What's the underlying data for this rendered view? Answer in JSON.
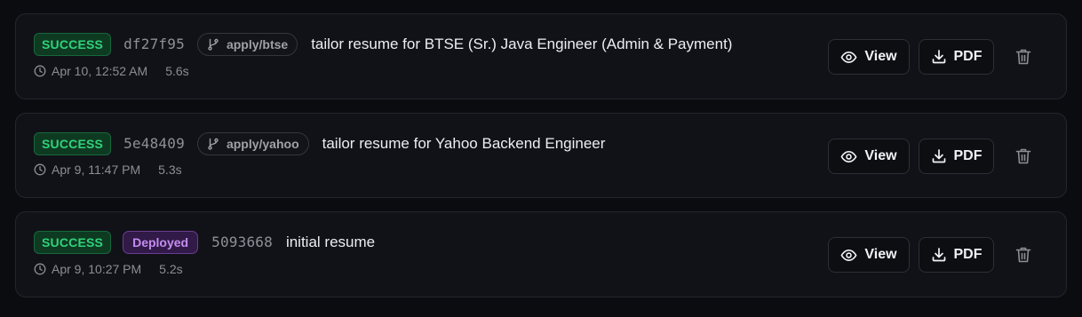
{
  "deployments": [
    {
      "status": "SUCCESS",
      "sha": "df27f95",
      "branch": "apply/btse",
      "deployed_label": "",
      "message": "tailor resume for BTSE (Sr.) Java Engineer (Admin & Payment)",
      "time": "Apr 10, 12:52 AM",
      "duration": "5.6s",
      "view_label": "View",
      "pdf_label": "PDF"
    },
    {
      "status": "SUCCESS",
      "sha": "5e48409",
      "branch": "apply/yahoo",
      "deployed_label": "",
      "message": "tailor resume for Yahoo Backend Engineer",
      "time": "Apr 9, 11:47 PM",
      "duration": "5.3s",
      "view_label": "View",
      "pdf_label": "PDF"
    },
    {
      "status": "SUCCESS",
      "sha": "5093668",
      "branch": "",
      "deployed_label": "Deployed",
      "message": "initial resume",
      "time": "Apr 9, 10:27 PM",
      "duration": "5.2s",
      "view_label": "View",
      "pdf_label": "PDF"
    }
  ],
  "colors": {
    "success": "#31d27a",
    "deployed": "#c58cf2",
    "background": "#0b0c10",
    "card": "#111217"
  },
  "icons": {
    "branch": "git-branch-icon",
    "clock": "clock-icon",
    "view": "eye-icon",
    "pdf": "download-icon",
    "delete": "trash-icon"
  }
}
